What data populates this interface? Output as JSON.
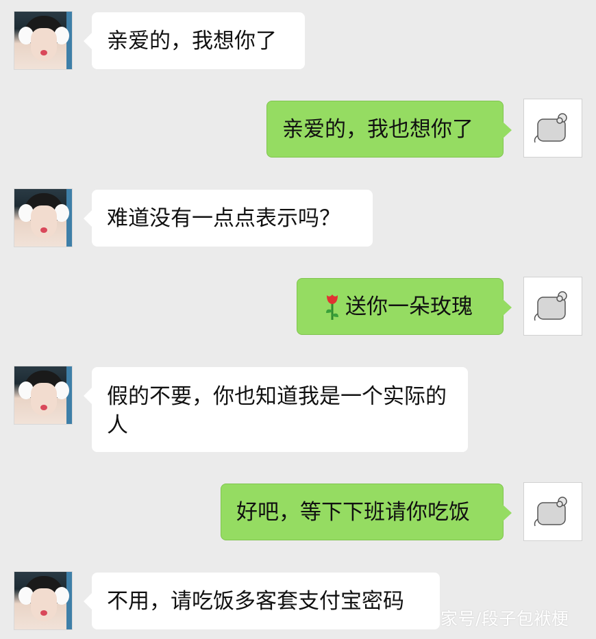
{
  "conversation": {
    "messages": [
      {
        "side": "left",
        "text": "亲爱的，我想你了"
      },
      {
        "side": "right",
        "text": "亲爱的，我也想你了"
      },
      {
        "side": "left",
        "text": "难道没有一点点表示吗？"
      },
      {
        "side": "right",
        "emoji": "rose-icon",
        "text": "送你一朵玫瑰"
      },
      {
        "side": "left",
        "text": "假的不要，你也知道我是一个实际的人"
      },
      {
        "side": "right",
        "text": "好吧，等下下班请你吃饭"
      },
      {
        "side": "left",
        "text": "不用，请吃饭多客套支付宝密码"
      }
    ]
  },
  "watermark": {
    "text": "家号/段子包袱梗"
  },
  "colors": {
    "background": "#ebebeb",
    "incoming_bubble": "#ffffff",
    "outgoing_bubble": "#95dc62"
  }
}
